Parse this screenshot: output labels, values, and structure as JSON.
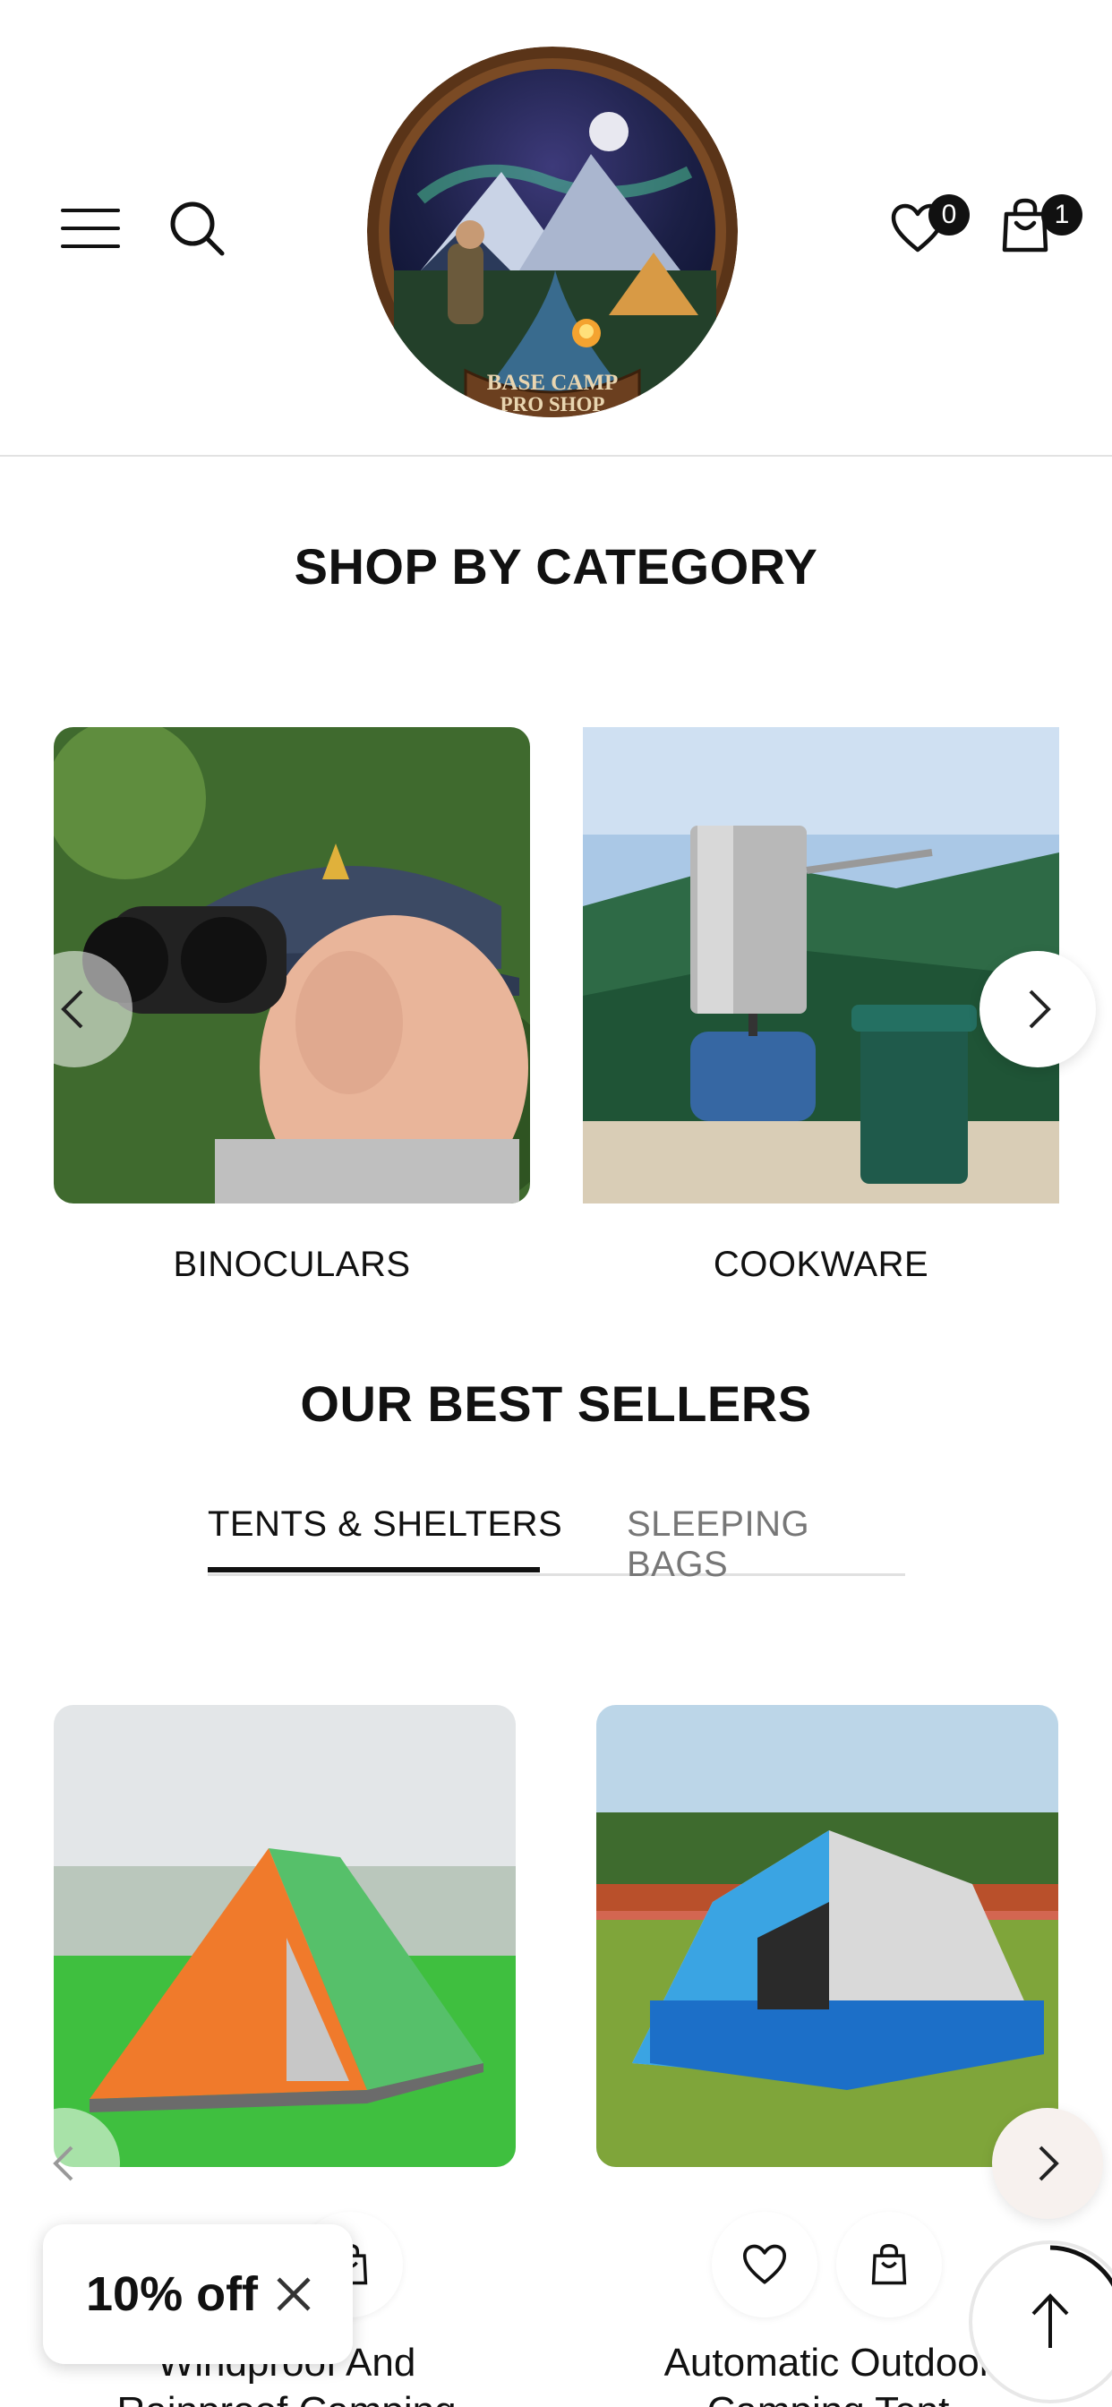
{
  "header": {
    "menu_icon": "hamburger-menu-icon",
    "search_icon": "search-icon",
    "wishlist_icon": "heart-icon",
    "cart_icon": "shopping-bag-icon",
    "wishlist_count": "0",
    "cart_count": "1",
    "logo": {
      "line1": "BASE CAMP",
      "line2": "PRO SHOP"
    }
  },
  "categories": {
    "title": "SHOP BY CATEGORY",
    "items": [
      {
        "label": "BINOCULARS"
      },
      {
        "label": "COOKWARE"
      }
    ],
    "prev_icon": "chevron-left-icon",
    "next_icon": "chevron-right-icon"
  },
  "best_sellers": {
    "title": "OUR BEST SELLERS",
    "tabs": [
      {
        "label": "TENTS & SHELTERS",
        "active": true
      },
      {
        "label": "SLEEPING BAGS",
        "active": false
      }
    ],
    "products": [
      {
        "title_line1": "Windproof And",
        "title_line2": "Rainproof Camping"
      },
      {
        "title_line1": "Automatic Outdoor",
        "title_line2": "Camping Tent"
      }
    ]
  },
  "discount": {
    "label": "10% off",
    "close_icon": "close-icon"
  },
  "back_to_top_icon": "arrow-up-icon",
  "colors": {
    "text": "#111111",
    "muted": "#777777",
    "badge": "#111111",
    "border": "#e2e2e2"
  }
}
